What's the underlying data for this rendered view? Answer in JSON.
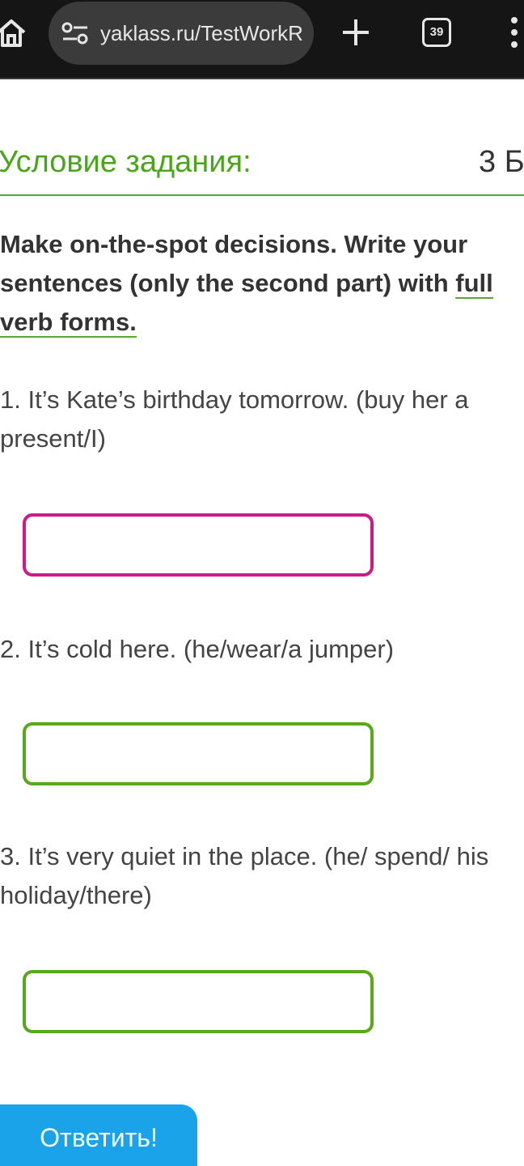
{
  "browser": {
    "url": "yaklass.ru/TestWorkR",
    "tab_count": "39",
    "icons": {
      "home": "home-icon",
      "site_info": "tune-icon",
      "new_tab": "plus-icon",
      "tabs": "tabs-icon",
      "menu": "more-vert-icon"
    }
  },
  "task": {
    "title": "Условие задания:",
    "points": "3 Б.",
    "instruction_plain": "Make on-the-spot decisions. Write your sentences (only the second part) with",
    "instruction_link": "full verb forms.",
    "questions": [
      {
        "text": "1. It’s Kate’s birthday tomorrow. (buy her a present/I)",
        "answer": ""
      },
      {
        "text": "2. It’s cold here. (he/wear/a jumper)",
        "answer": ""
      },
      {
        "text": "3. It’s very quiet in the place. (he/ spend/ his holiday/there)",
        "answer": ""
      }
    ],
    "submit_label": "Ответить!"
  },
  "colors": {
    "accent_green": "#4aa51a",
    "focus_magenta": "#cc1a86",
    "button_blue": "#1aa3e8",
    "toolbar_bg": "#151515"
  }
}
